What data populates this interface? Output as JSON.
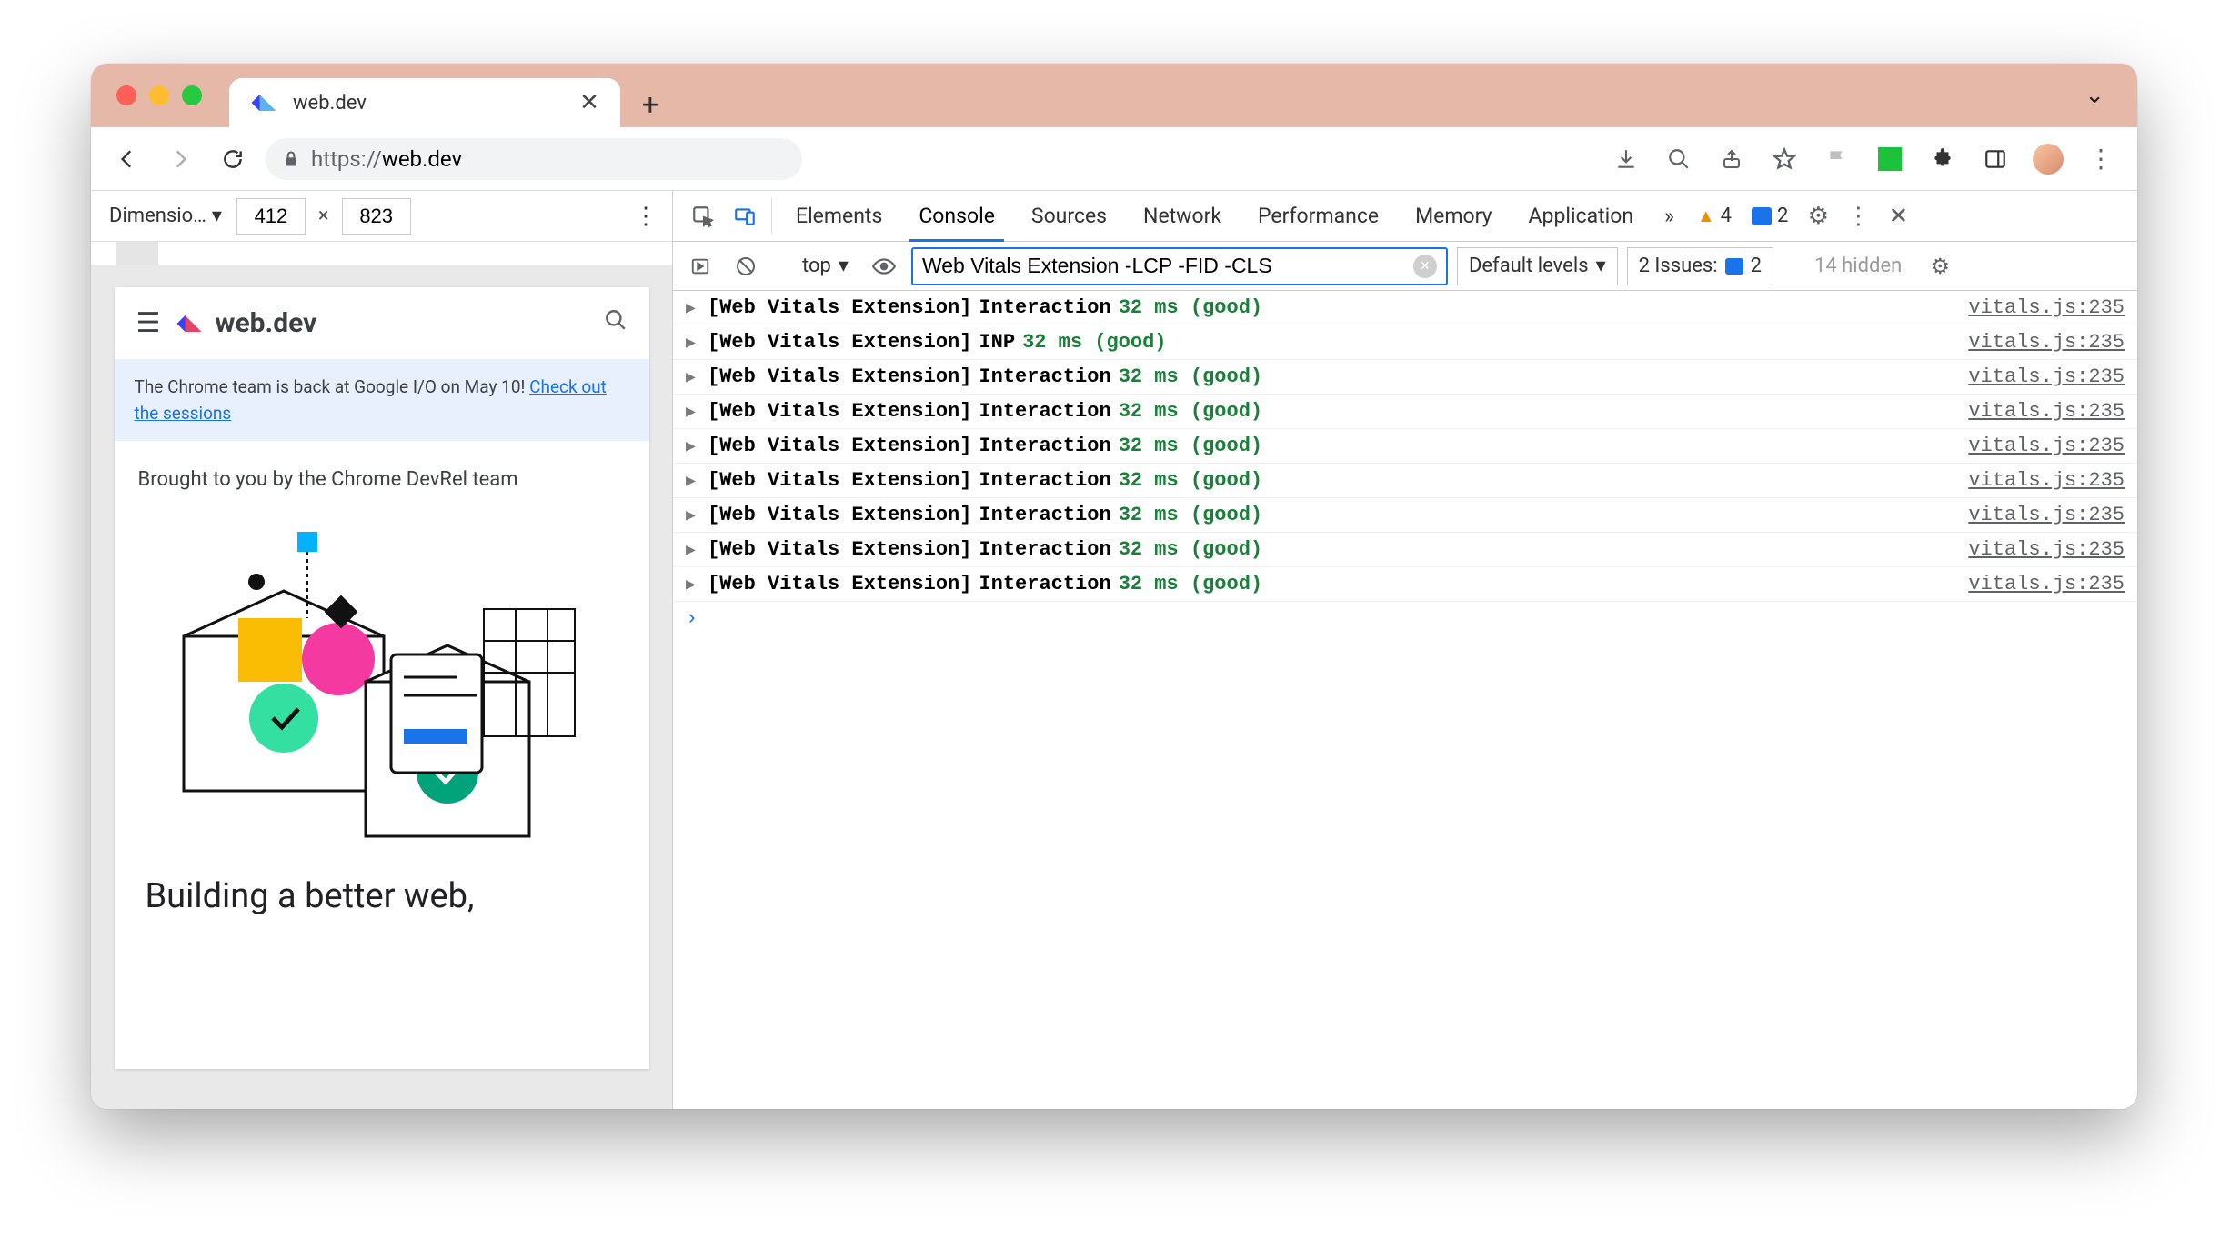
{
  "browser": {
    "tab_title": "web.dev",
    "url_scheme": "https://",
    "url_host": "web.dev",
    "nav_back": "←",
    "nav_forward": "→",
    "reload": "⟳",
    "lock": "🔒",
    "download": "⇩",
    "zoom": "🔍",
    "share": "⇧",
    "star": "☆",
    "flag": "⚑",
    "ext_puzzle": "✦",
    "panel": "▭",
    "menu": "⋮",
    "newtab": "+",
    "chev": "⌄",
    "tab_close": "✕"
  },
  "device_bar": {
    "label": "Dimensio…",
    "caret": "▾",
    "width": "412",
    "x": "×",
    "height": "823",
    "more": "⋮"
  },
  "page": {
    "brand": "web.dev",
    "banner_text": "The Chrome team is back at Google I/O on May 10! ",
    "banner_link": "Check out the sessions",
    "brought": "Brought to you by the Chrome DevRel team",
    "headline": "Building a better web,"
  },
  "devtools": {
    "tabs": [
      "Elements",
      "Console",
      "Sources",
      "Network",
      "Performance",
      "Memory",
      "Application"
    ],
    "active_tab": "Console",
    "more": "»",
    "warn_count": "4",
    "msg_count": "2",
    "gear": "⚙",
    "kebab": "⋮",
    "close": "✕"
  },
  "filter": {
    "play": "▶",
    "ban": "⊘",
    "context": "top",
    "caret": "▾",
    "eye": "👁",
    "value": "Web Vitals Extension -LCP -FID -CLS",
    "clear": "×",
    "levels": "Default levels",
    "issues_label": "2 Issues:",
    "issues_count": "2",
    "hidden": "14 hidden",
    "gear": "⚙"
  },
  "console": {
    "source": "vitals.js:235",
    "lines": [
      {
        "prefix": "[Web Vitals Extension]",
        "metric": "Interaction",
        "value": "32 ms (good)"
      },
      {
        "prefix": "[Web Vitals Extension]",
        "metric": "INP",
        "value": "32 ms (good)"
      },
      {
        "prefix": "[Web Vitals Extension]",
        "metric": "Interaction",
        "value": "32 ms (good)"
      },
      {
        "prefix": "[Web Vitals Extension]",
        "metric": "Interaction",
        "value": "32 ms (good)"
      },
      {
        "prefix": "[Web Vitals Extension]",
        "metric": "Interaction",
        "value": "32 ms (good)"
      },
      {
        "prefix": "[Web Vitals Extension]",
        "metric": "Interaction",
        "value": "32 ms (good)"
      },
      {
        "prefix": "[Web Vitals Extension]",
        "metric": "Interaction",
        "value": "32 ms (good)"
      },
      {
        "prefix": "[Web Vitals Extension]",
        "metric": "Interaction",
        "value": "32 ms (good)"
      },
      {
        "prefix": "[Web Vitals Extension]",
        "metric": "Interaction",
        "value": "32 ms (good)"
      }
    ],
    "prompt": "›"
  }
}
